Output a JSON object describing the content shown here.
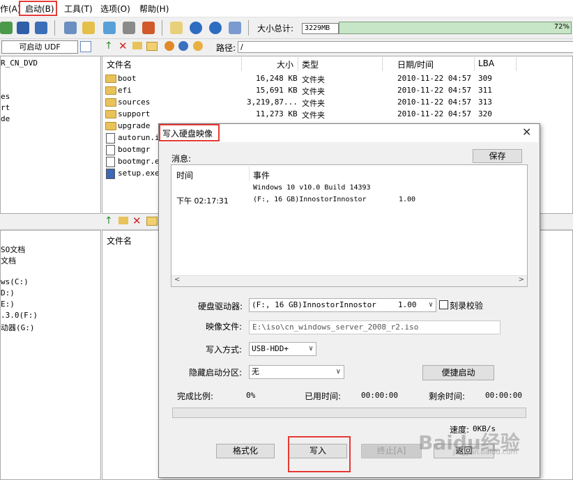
{
  "menu": {
    "items": [
      "作(A)",
      "启动(B)",
      "工具(T)",
      "选项(O)",
      "帮助(H)"
    ]
  },
  "toolbar": {
    "size_total_label": "大小总计:",
    "size_total_value": "3229MB",
    "size_bar_text": "72%"
  },
  "bar2": {
    "bootable_label": "可启动 UDF",
    "path_label": "路径:",
    "path_value": "/"
  },
  "left_tree_top": [
    "R_CN_DVD",
    "es",
    "rt",
    "de"
  ],
  "left_tree_bottom": [
    "SO文档",
    "文档",
    "ws(C:)",
    "D:)",
    "E:)",
    ".3.0(F:)",
    "动器(G:)"
  ],
  "file_list": {
    "headers": [
      "文件名",
      "大小",
      "类型",
      "日期/时间",
      "LBA"
    ],
    "rows": [
      {
        "name": "boot",
        "size": "16,248 KB",
        "type": "文件夹",
        "date": "2010-11-22 04:57",
        "lba": "309",
        "icon": "folder-icon"
      },
      {
        "name": "efi",
        "size": "15,691 KB",
        "type": "文件夹",
        "date": "2010-11-22 04:57",
        "lba": "311",
        "icon": "folder-icon"
      },
      {
        "name": "sources",
        "size": "3,219,87...",
        "type": "文件夹",
        "date": "2010-11-22 04:57",
        "lba": "313",
        "icon": "folder-icon"
      },
      {
        "name": "support",
        "size": "11,273 KB",
        "type": "文件夹",
        "date": "2010-11-22 04:57",
        "lba": "320",
        "icon": "folder-icon"
      },
      {
        "name": "upgrade",
        "size": "",
        "type": "",
        "date": "",
        "lba": "",
        "icon": "folder-icon"
      },
      {
        "name": "autorun.in",
        "size": "",
        "type": "",
        "date": "",
        "lba": "",
        "icon": "file-icon"
      },
      {
        "name": "bootmgr",
        "size": "",
        "type": "",
        "date": "",
        "lba": "",
        "icon": "file-icon"
      },
      {
        "name": "bootmgr.ef",
        "size": "",
        "type": "",
        "date": "",
        "lba": "",
        "icon": "file-icon"
      },
      {
        "name": "setup.exe",
        "size": "",
        "type": "",
        "date": "",
        "lba": "",
        "icon": "exe-icon"
      }
    ]
  },
  "lower_list": {
    "header": "文件名"
  },
  "dialog": {
    "title": "写入硬盘映像",
    "messages_label": "消息:",
    "save_button": "保存",
    "msg_headers": [
      "时间",
      "事件"
    ],
    "msg_event_line1": "Windows 10 v10.0 Build 14393",
    "msg_time": "下午 02:17:31",
    "msg_event_line2": "(F:, 16 GB)InnostorInnostor",
    "msg_event_value": "1.00",
    "drive_label": "硬盘驱动器:",
    "drive_value": "(F:, 16 GB)InnostorInnostor",
    "drive_value_num": "1.00",
    "verify_label": "刻录校验",
    "image_label": "映像文件:",
    "image_value": "E:\\iso\\cn_windows_server_2008_r2.iso",
    "write_method_label": "写入方式:",
    "write_method_value": "USB-HDD+",
    "hidden_part_label": "隐藏启动分区:",
    "hidden_part_value": "无",
    "quick_boot_button": "便捷启动",
    "progress_label": "完成比例:",
    "progress_value": "0%",
    "elapsed_label": "已用时间:",
    "elapsed_value": "00:00:00",
    "remaining_label": "剩余时间:",
    "remaining_value": "00:00:00",
    "speed_label": "速度:",
    "speed_value": "0KB/s",
    "format_button": "格式化",
    "write_button": "写入",
    "stop_button": "终止[A]",
    "return_button": "返回",
    "progress_fraction": 0
  },
  "watermark": {
    "text": "Baidu经验",
    "sub": "jingyan.baidu.com"
  },
  "colors": {
    "highlight_red": "#e53935",
    "size_bar_fill": "#c7e6c7"
  }
}
